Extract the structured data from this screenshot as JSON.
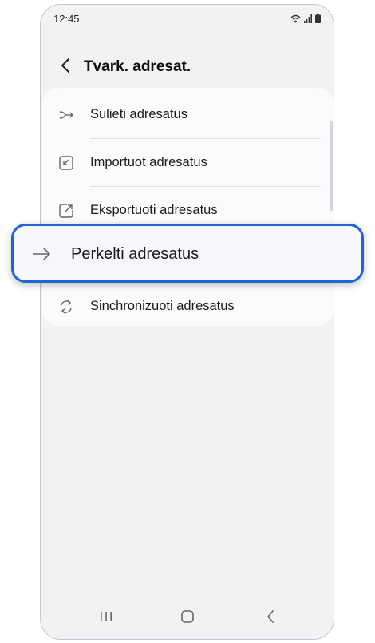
{
  "status_bar": {
    "time": "12:45",
    "icons": [
      "wifi-icon",
      "signal-icon",
      "battery-icon"
    ]
  },
  "header": {
    "back_icon": "chevron-left-icon",
    "title": "Tvark. adresat."
  },
  "menu": {
    "items": [
      {
        "label": "Sulieti adresatus",
        "icon": "merge-icon"
      },
      {
        "label": "Importuot adresatus",
        "icon": "import-icon"
      },
      {
        "label": "Eksportuoti adresatus",
        "icon": "export-icon"
      },
      {
        "label": "Perkelti adresatus",
        "icon": "arrow-right-icon",
        "highlighted": true
      },
      {
        "label": "Sinchronizuoti adresatus",
        "icon": "sync-icon"
      }
    ]
  },
  "nav_bar": {
    "buttons": [
      "recents-icon",
      "home-icon",
      "back-icon"
    ]
  },
  "colors": {
    "highlight_border": "#1e64d2",
    "screen_background": "#f2f2f4",
    "card_background": "#fbfbfd"
  }
}
